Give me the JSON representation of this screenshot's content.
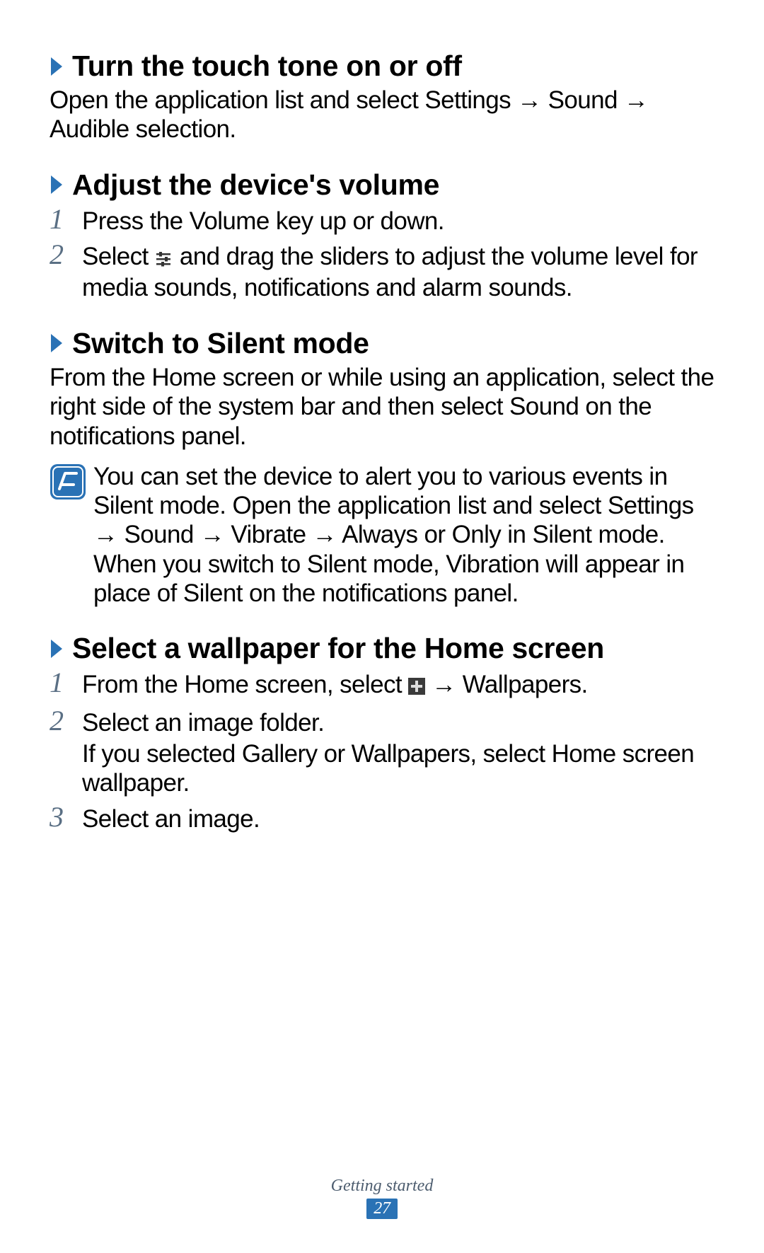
{
  "sections": {
    "touch_tone": {
      "heading": "Turn the touch tone on or off",
      "body": "Open the application list and select Settings → Sound → Audible selection."
    },
    "volume": {
      "heading": "Adjust the device's volume",
      "steps": [
        "Press the Volume key up or down.",
        ""
      ],
      "step2_pre": "Select ",
      "step2_post": " and drag the sliders to adjust the volume level for media sounds, notifications and alarm sounds."
    },
    "silent": {
      "heading": "Switch to Silent mode",
      "body": "From the Home screen or while using an application, select the right side of the system bar and then select Sound on the notifications panel.",
      "note": "You can set the device to alert you to various events in Silent mode. Open the application list and select Settings → Sound → Vibrate → Always or Only in Silent mode. When you switch to Silent mode, Vibration will appear in place of Silent on the notifications panel."
    },
    "wallpaper": {
      "heading": "Select a wallpaper for the Home screen",
      "step1_pre": "From the Home screen, select ",
      "step1_post": " → Wallpapers.",
      "step2_line1": "Select an image folder.",
      "step2_line2": "If you selected Gallery or Wallpapers, select Home screen wallpaper.",
      "step3": "Select an image."
    }
  },
  "nums": {
    "n1": "1",
    "n2": "2",
    "n3": "3"
  },
  "footer": {
    "section": "Getting started",
    "page": "27"
  }
}
